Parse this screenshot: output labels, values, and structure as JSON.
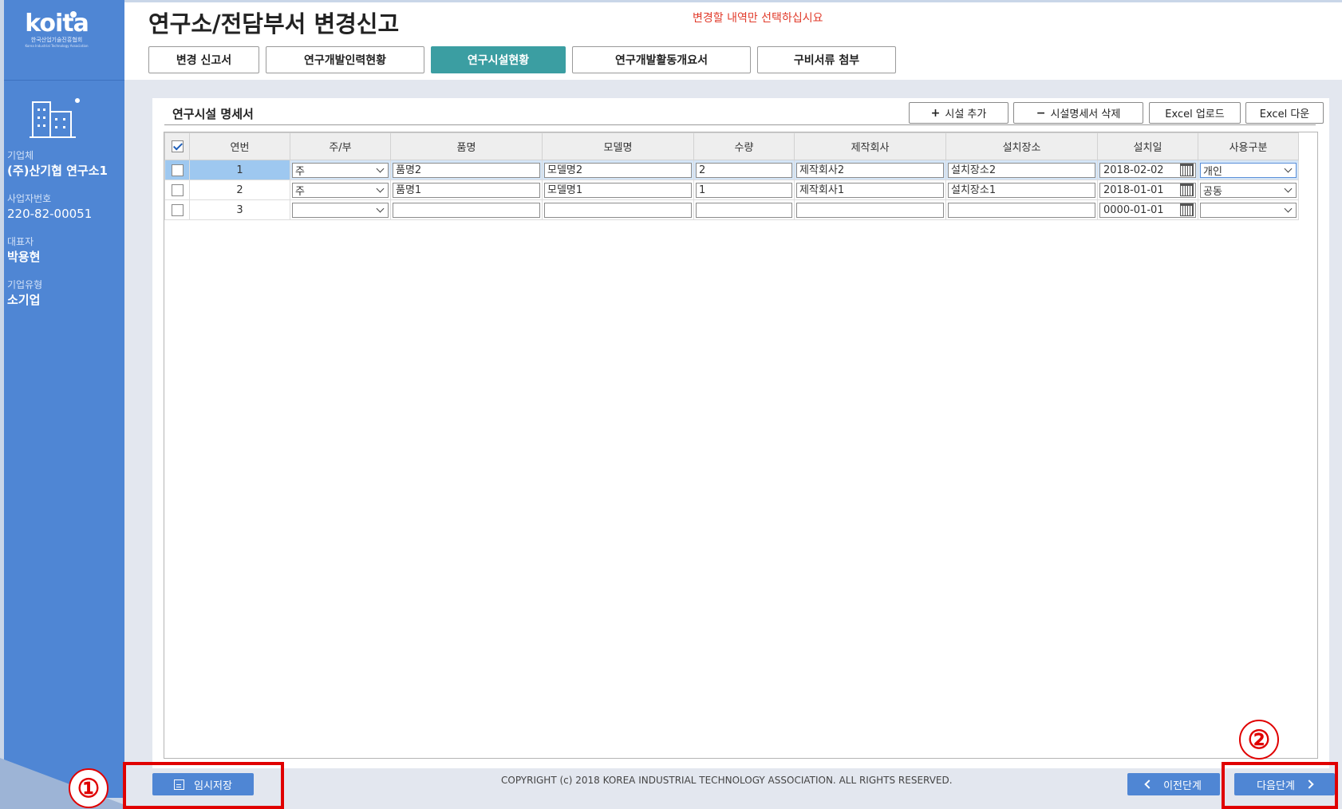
{
  "sidebar": {
    "logo_text": "koita",
    "logo_subtitle": "한국산업기술진흥협회",
    "logo_subtitle_en": "Korea Industrial Technology Association",
    "company_label": "기업체",
    "company_value": "(주)산기협 연구소1",
    "bizno_label": "사업자번호",
    "bizno_value": "220-82-00051",
    "ceo_label": "대표자",
    "ceo_value": "박용현",
    "type_label": "기업유형",
    "type_value": "소기업"
  },
  "header": {
    "title": "연구소/전담부서 변경신고",
    "notice": "변경할 내역만 선택하십시요",
    "tabs": [
      {
        "label": "변경 신고서",
        "active": false
      },
      {
        "label": "연구개발인력현황",
        "active": false
      },
      {
        "label": "연구시설현황",
        "active": true
      },
      {
        "label": "연구개발활동개요서",
        "active": false
      },
      {
        "label": "구비서류 첨부",
        "active": false
      }
    ]
  },
  "panel": {
    "title": "연구시설 명세서",
    "buttons": {
      "add": "시설 추가",
      "add_icon": "+",
      "delete": "시설명세서 삭제",
      "delete_icon": "−",
      "excel_upload": "Excel 업로드",
      "excel_download": "Excel 다운"
    },
    "columns": [
      "연번",
      "주/부",
      "품명",
      "모델명",
      "수량",
      "제작회사",
      "설치장소",
      "설치일",
      "사용구분"
    ],
    "rows": [
      {
        "no": "1",
        "main": "주",
        "name": "품명2",
        "model": "모델명2",
        "qty": "2",
        "maker": "제작회사2",
        "place": "설치장소2",
        "date": "2018-02-02",
        "usage": "개인",
        "selected": true
      },
      {
        "no": "2",
        "main": "주",
        "name": "품명1",
        "model": "모델명1",
        "qty": "1",
        "maker": "제작회사1",
        "place": "설치장소1",
        "date": "2018-01-01",
        "usage": "공동",
        "selected": false
      },
      {
        "no": "3",
        "main": "",
        "name": "",
        "model": "",
        "qty": "",
        "maker": "",
        "place": "",
        "date": "0000-01-01",
        "usage": "",
        "selected": false
      }
    ]
  },
  "footer": {
    "save_label": "임시저장",
    "copyright": "COPYRIGHT (c) 2018 KOREA INDUSTRIAL TECHNOLOGY ASSOCIATION. ALL RIGHTS RESERVED.",
    "prev_label": "이전단계",
    "next_label": "다음단계"
  },
  "annotations": {
    "marker_1": "①",
    "marker_2": "②",
    "color": "#e00000"
  },
  "colors": {
    "sidebar": "#4f86d4",
    "active_tab": "#3b9ea2",
    "notice": "#e13b2b"
  }
}
